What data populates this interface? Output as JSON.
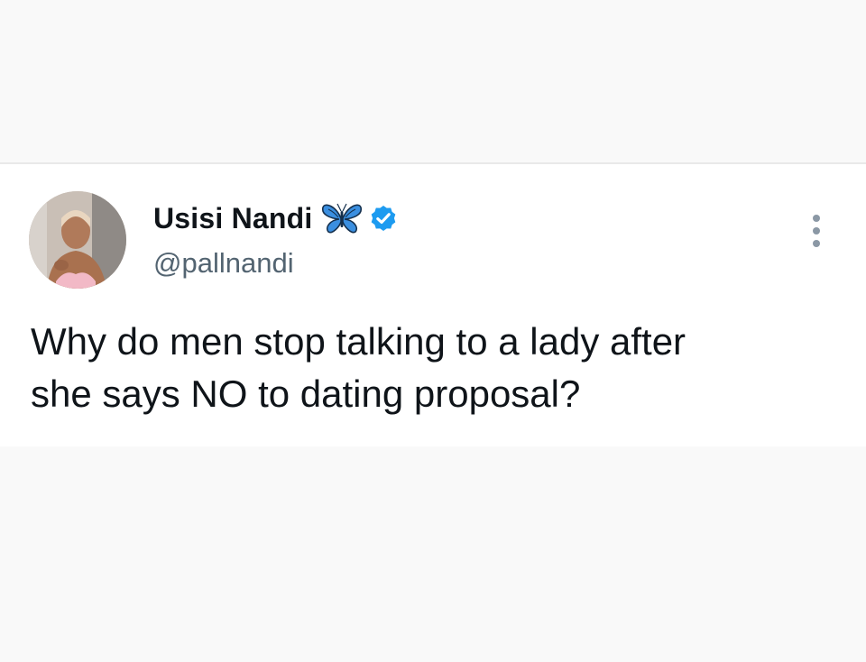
{
  "tweet": {
    "author": {
      "display_name": "Usisi Nandi",
      "handle": "@pallnandi",
      "name_emoji_icon": "butterfly-icon",
      "verified_icon": "verified-badge-icon",
      "verified_color": "#1d9bf0"
    },
    "text_line_1": "Why do men stop talking to a lady after",
    "text_line_2": "she says NO to dating proposal?",
    "menu_icon": "more-options-icon"
  },
  "colors": {
    "text_primary": "#0f1419",
    "text_secondary": "#536471",
    "page_background": "#f9f9f9",
    "card_background": "#ffffff"
  }
}
